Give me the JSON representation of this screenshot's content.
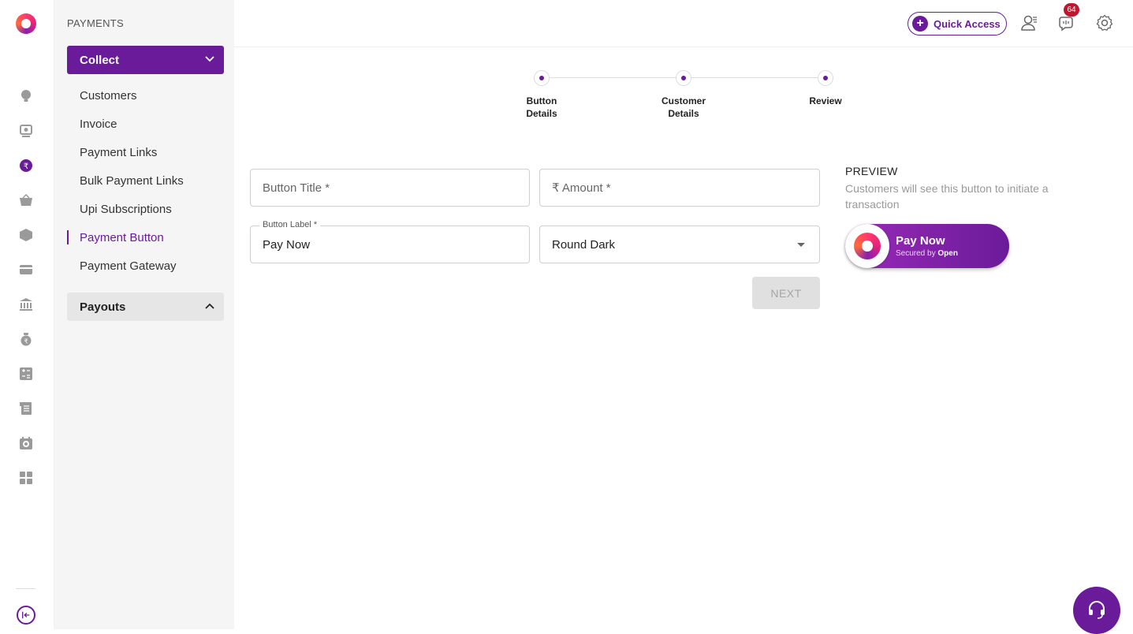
{
  "sidebar": {
    "section_title": "PAYMENTS",
    "collect_label": "Collect",
    "items": [
      {
        "label": "Customers",
        "active": false
      },
      {
        "label": "Invoice",
        "active": false
      },
      {
        "label": "Payment Links",
        "active": false
      },
      {
        "label": "Bulk Payment Links",
        "active": false
      },
      {
        "label": "Upi Subscriptions",
        "active": false
      },
      {
        "label": "Payment Button",
        "active": true
      },
      {
        "label": "Payment Gateway",
        "active": false
      }
    ],
    "payouts_label": "Payouts"
  },
  "rail": {
    "icons": [
      "bulb-icon",
      "dashboard-icon",
      "payments-icon",
      "basket-icon",
      "box-icon",
      "card-icon",
      "bank-icon",
      "money-bag-icon",
      "calculator-icon",
      "ledger-icon",
      "receipt-icon",
      "apps-icon"
    ],
    "active_icon": "payments-icon"
  },
  "topbar": {
    "quick_access_label": "Quick Access",
    "notification_count": "64"
  },
  "stepper": {
    "steps": [
      "Button Details",
      "Customer Details",
      "Review"
    ]
  },
  "form": {
    "button_title": {
      "placeholder": "Button Title *",
      "value": ""
    },
    "amount": {
      "placeholder": "₹ Amount *",
      "value": ""
    },
    "button_label": {
      "label": "Button Label *",
      "value": "Pay Now"
    },
    "style_select": {
      "value": "Round Dark"
    },
    "next_label": "NEXT"
  },
  "preview": {
    "title": "PREVIEW",
    "description": "Customers will see this button to initiate a transaction",
    "button_label": "Pay Now",
    "secured_prefix": "Secured by",
    "secured_brand": "Open"
  },
  "colors": {
    "brand": "#6a1b9a",
    "badge": "#c0162e"
  }
}
